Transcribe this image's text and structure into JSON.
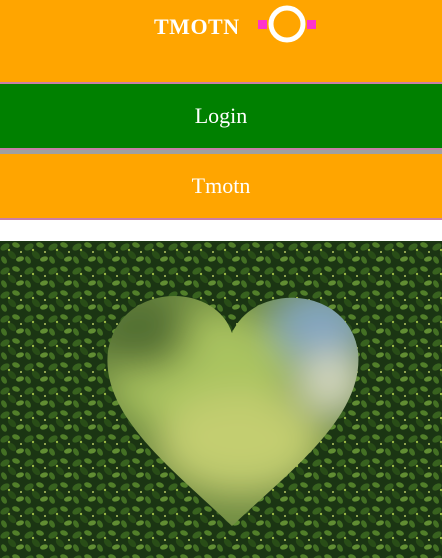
{
  "header": {
    "brand": "TMOTN",
    "logo_icon": "ring-logo-icon"
  },
  "nav": {
    "login_label": "Login",
    "tmotn_label": "Tmotn"
  },
  "colors": {
    "header_bg": "#ffa500",
    "login_bg": "#008000",
    "tmotn_bg": "#ffa500",
    "separator": "#c97fa8",
    "logo_accent": "#ff33cc"
  },
  "hero": {
    "description_icon": "heart-hedge-image"
  }
}
